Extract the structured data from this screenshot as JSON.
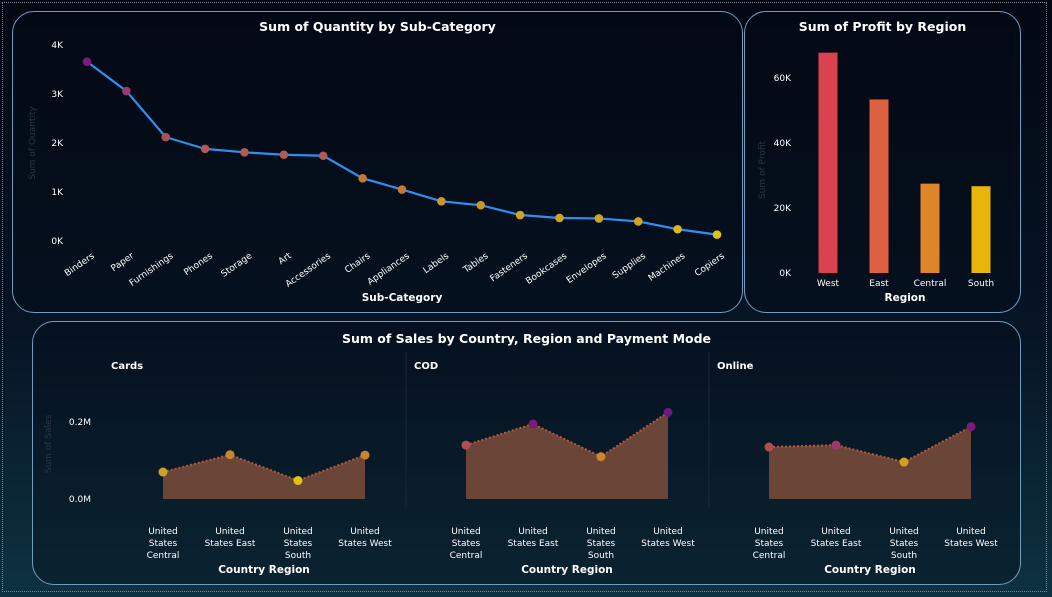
{
  "chart_data": [
    {
      "type": "line",
      "title": "Sum of Quantity by Sub-Category",
      "xlabel": "Sub-Category",
      "ylabel": "Sum of Quantity",
      "ylim": [
        0,
        4000
      ],
      "yticks": [
        "0K",
        "1K",
        "2K",
        "3K",
        "4K"
      ],
      "line_color": "#2f8ff0",
      "categories": [
        "Binders",
        "Paper",
        "Furnishings",
        "Phones",
        "Storage",
        "Art",
        "Accessories",
        "Chairs",
        "Appliances",
        "Labels",
        "Tables",
        "Fasteners",
        "Bookcases",
        "Envelopes",
        "Supplies",
        "Machines",
        "Copiers"
      ],
      "values": [
        3660,
        3060,
        2120,
        1880,
        1810,
        1760,
        1740,
        1280,
        1050,
        810,
        730,
        530,
        470,
        460,
        400,
        240,
        130
      ],
      "point_colors": [
        "#7a1a7a",
        "#9c3a6a",
        "#b04e55",
        "#b25a54",
        "#b25a54",
        "#b25a54",
        "#b25a54",
        "#c77730",
        "#c77730",
        "#c8962a",
        "#c8962a",
        "#cfa520",
        "#cfa520",
        "#cfa520",
        "#cfa520",
        "#d9b718",
        "#e0c20f"
      ]
    },
    {
      "type": "bar",
      "title": "Sum of Profit by Region",
      "xlabel": "Region",
      "ylabel": "Sum of Profit",
      "ylim": [
        0,
        70000
      ],
      "yticks": [
        "0K",
        "20K",
        "40K",
        "60K"
      ],
      "categories": [
        "West",
        "East",
        "Central",
        "South"
      ],
      "values": [
        67800,
        53400,
        27500,
        26700
      ],
      "colors": [
        "#d9424e",
        "#dd6141",
        "#dd8629",
        "#e8b60a"
      ]
    },
    {
      "type": "area",
      "title": "Sum of Sales by Country, Region and Payment Mode",
      "xlabel": "Country Region",
      "ylabel": "Sum of Sales",
      "ylim": [
        0,
        0.3
      ],
      "yticks": [
        "0.0M",
        "0.2M"
      ],
      "categories": [
        "United States Central",
        "United States East",
        "United States South",
        "United States West"
      ],
      "fill_color": "#6b4538",
      "series": [
        {
          "name": "Cards",
          "values": [
            0.07,
            0.115,
            0.048,
            0.114
          ],
          "point_colors": [
            "#d0a020",
            "#c8862e",
            "#e0c20f",
            "#c8862e"
          ]
        },
        {
          "name": "COD",
          "values": [
            0.14,
            0.195,
            0.11,
            0.225
          ],
          "point_colors": [
            "#b04e55",
            "#7a1a7a",
            "#c8862e",
            "#6a1a80"
          ]
        },
        {
          "name": "Online",
          "values": [
            0.135,
            0.14,
            0.096,
            0.188
          ],
          "point_colors": [
            "#b04e55",
            "#9c3a6a",
            "#d0a020",
            "#7a1a7a"
          ]
        }
      ]
    }
  ]
}
